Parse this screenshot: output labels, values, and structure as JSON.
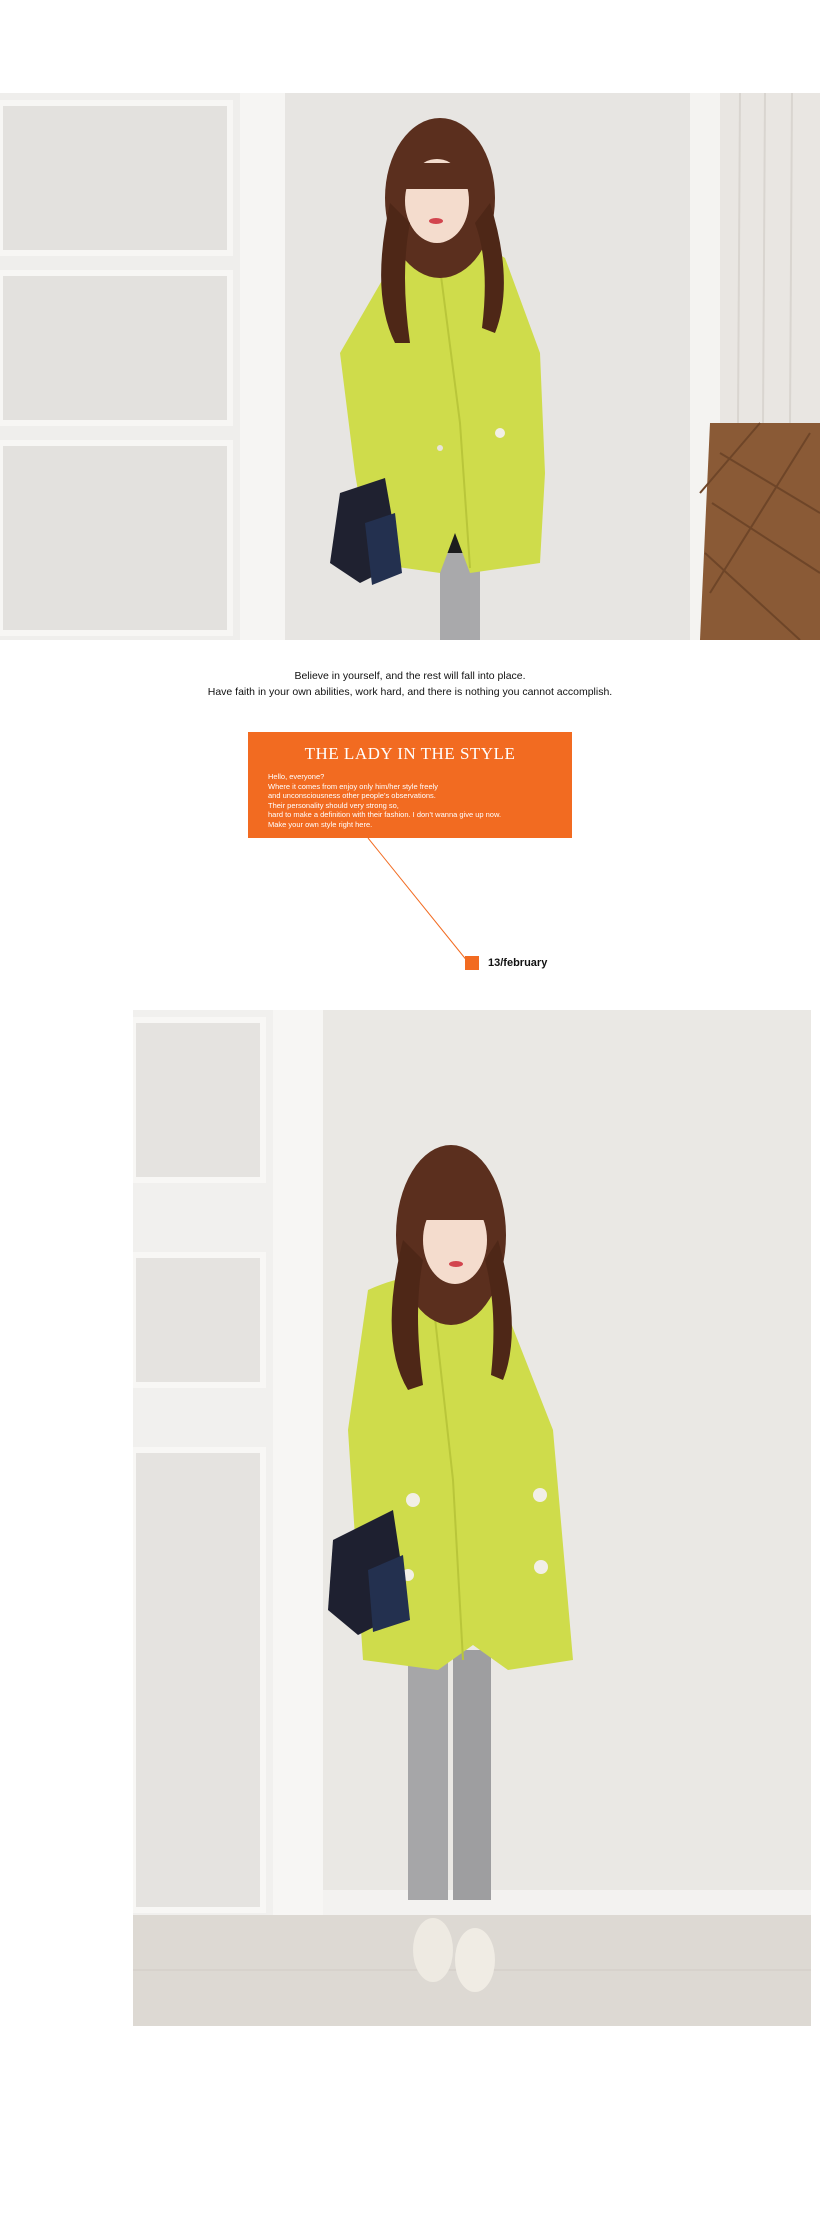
{
  "quote": {
    "line1": "Believe in yourself, and the rest will fall into place.",
    "line2": "Have faith in your own abilities, work hard, and there is nothing you cannot accomplish."
  },
  "box": {
    "title": "THE LADY IN THE STYLE",
    "lines": [
      "Hello, everyone?",
      "Where it comes from enjoy only him/her style freely",
      "and unconsciousness other people’s observations.",
      "Their personality should very strong so,",
      "hard to make a definition with their fashion. I don’t wanna give up now.",
      "Make your own style right here."
    ]
  },
  "date": {
    "label": "13/february"
  },
  "photos": {
    "top": "photo-model-yellow-coat-waist-up",
    "bottom": "photo-model-yellow-coat-full-length"
  },
  "colors": {
    "accent": "#f26b21",
    "coat": "#cddc4a",
    "background": "#ffffff"
  }
}
